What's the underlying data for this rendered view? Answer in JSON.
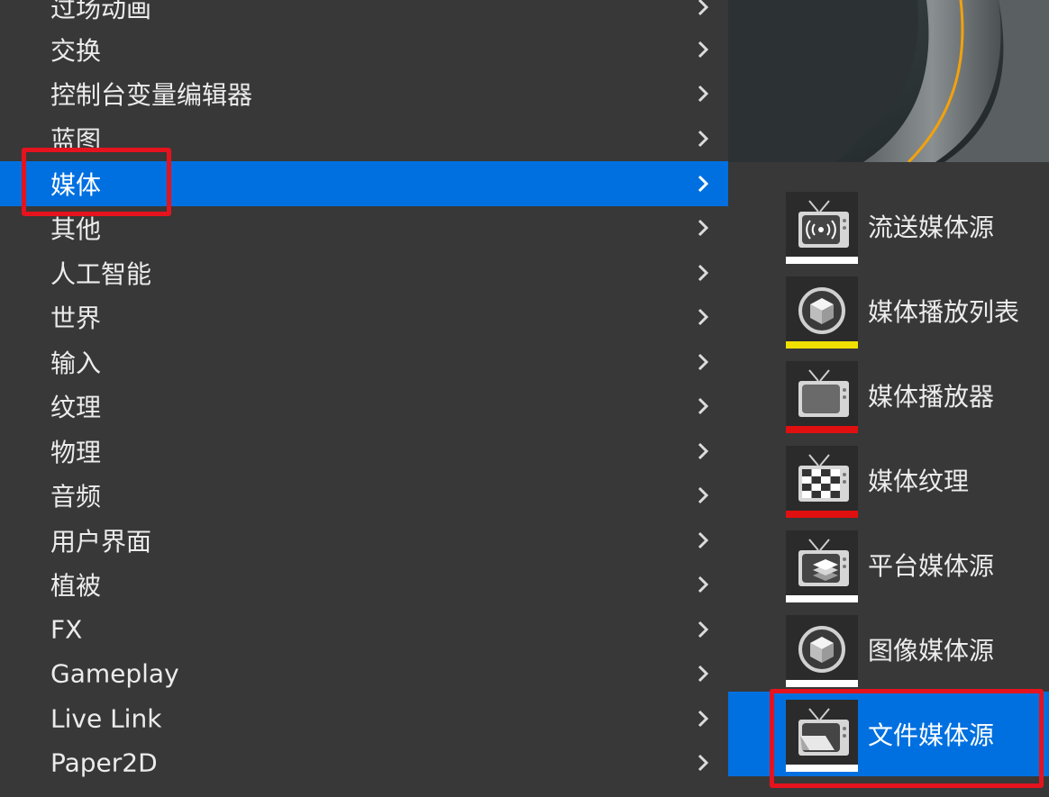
{
  "left_menu": {
    "items": [
      {
        "label": "过场动画",
        "chevron": "chevron-right-icon"
      },
      {
        "label": "交换",
        "chevron": "chevron-right-icon"
      },
      {
        "label": "控制台变量编辑器",
        "chevron": "chevron-right-icon"
      },
      {
        "label": "蓝图",
        "chevron": "chevron-right-icon"
      },
      {
        "label": "媒体",
        "chevron": "chevron-right-icon",
        "selected": true
      },
      {
        "label": "其他",
        "chevron": "chevron-right-icon"
      },
      {
        "label": "人工智能",
        "chevron": "chevron-right-icon"
      },
      {
        "label": "世界",
        "chevron": "chevron-right-icon"
      },
      {
        "label": "输入",
        "chevron": "chevron-right-icon"
      },
      {
        "label": "纹理",
        "chevron": "chevron-right-icon"
      },
      {
        "label": "物理",
        "chevron": "chevron-right-icon"
      },
      {
        "label": "音频",
        "chevron": "chevron-right-icon"
      },
      {
        "label": "用户界面",
        "chevron": "chevron-right-icon"
      },
      {
        "label": "植被",
        "chevron": "chevron-right-icon"
      },
      {
        "label": "FX",
        "chevron": "chevron-right-icon"
      },
      {
        "label": "Gameplay",
        "chevron": "chevron-right-icon"
      },
      {
        "label": "Live Link",
        "chevron": "chevron-right-icon"
      },
      {
        "label": "Paper2D",
        "chevron": "chevron-right-icon"
      }
    ]
  },
  "submenu": {
    "items": [
      {
        "label": "流送媒体源",
        "icon": "stream-media-source-icon",
        "bar_color": "#ffffff"
      },
      {
        "label": "媒体播放列表",
        "icon": "media-playlist-icon",
        "bar_color": "#f0e000"
      },
      {
        "label": "媒体播放器",
        "icon": "media-player-icon",
        "bar_color": "#e01010"
      },
      {
        "label": "媒体纹理",
        "icon": "media-texture-icon",
        "bar_color": "#e01010"
      },
      {
        "label": "平台媒体源",
        "icon": "platform-media-source-icon",
        "bar_color": "#ffffff"
      },
      {
        "label": "图像媒体源",
        "icon": "image-media-source-icon",
        "bar_color": "#ffffff"
      },
      {
        "label": "文件媒体源",
        "icon": "file-media-source-icon",
        "bar_color": "#ffffff",
        "selected": true
      }
    ]
  },
  "colors": {
    "selection": "#0070e0",
    "highlight_box": "#e5131d",
    "menu_bg": "#383838"
  }
}
